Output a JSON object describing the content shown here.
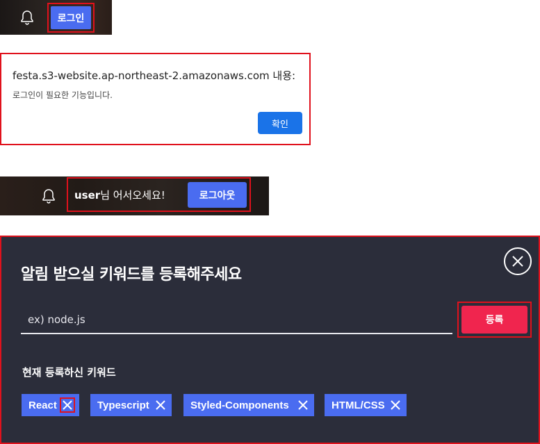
{
  "header": {
    "bell_icon": "bell-icon",
    "login_label": "로그인"
  },
  "alert": {
    "title": "festa.s3-website.ap-northeast-2.amazonaws.com 내용:",
    "message": "로그인이 필요한 기능입니다.",
    "ok_label": "확인"
  },
  "header_logged_in": {
    "bell_icon": "bell-icon",
    "username": "user",
    "greeting_suffix": "님 어서오세요!",
    "logout_label": "로그아웃"
  },
  "keyword_modal": {
    "title": "알림 받으실 키워드를 등록해주세요",
    "close_icon": "close-circle-icon",
    "input_placeholder": "ex) node.js",
    "input_value": "",
    "register_label": "등록",
    "current_label": "현재 등록하신 키워드",
    "keywords": [
      {
        "label": "React"
      },
      {
        "label": "Typescript"
      },
      {
        "label": "Styled-Components"
      },
      {
        "label": "HTML/CSS"
      }
    ]
  },
  "colors": {
    "accent_blue": "#4a6cf0",
    "register_red": "#f0254e",
    "highlight_red": "#e0111c",
    "modal_bg": "#2b2d3a",
    "dialog_button": "#1a73e8"
  }
}
